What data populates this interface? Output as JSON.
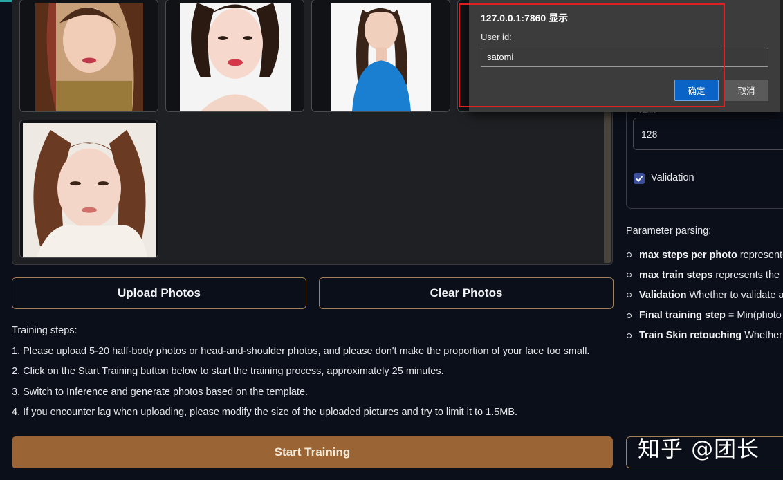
{
  "gallery": {
    "photos": [
      {
        "alt": "portrait photo 1"
      },
      {
        "alt": "portrait photo 2"
      },
      {
        "alt": "portrait photo 3"
      },
      {
        "alt": "portrait photo 4"
      },
      {
        "alt": "portrait photo 5"
      }
    ]
  },
  "buttons": {
    "upload": "Upload Photos",
    "clear": "Clear Photos",
    "start": "Start Training"
  },
  "steps": {
    "title": "Training steps:",
    "items": [
      "1. Please upload 5-20 half-body photos or head-and-shoulder photos, and please don't make the proportion of your face too small.",
      "2. Click on the Start Training button below to start the training process, approximately 25 minutes.",
      "3. Switch to Inference and generate photos based on the template.",
      "4. If you encounter lag when uploading, please modify the size of the uploaded pictures and try to limit it to 1.5MB."
    ]
  },
  "settings": {
    "rank_label": "rank",
    "rank_value": "128",
    "validation_label": "Validation",
    "validation_checked": true
  },
  "params": {
    "title": "Parameter parsing:",
    "items": [
      {
        "key": "max steps per photo",
        "text": "represents"
      },
      {
        "key": "max train steps",
        "text": "represents the m"
      },
      {
        "key": "Validation",
        "text": "Whether to validate a"
      },
      {
        "key": "Final training step",
        "text": "= Min(photo_"
      },
      {
        "key": "Train Skin retouching",
        "text": "Whether t"
      }
    ]
  },
  "dialog": {
    "title": "127.0.0.1:7860 显示",
    "label": "User id:",
    "input_value": "satomi",
    "ok": "确定",
    "cancel": "取消"
  },
  "watermark": "知乎 @团长",
  "colors": {
    "accent": "#9a6435",
    "border_accent": "#a58058",
    "dialog_ok": "#0a63c6",
    "highlight_frame": "#e02020"
  }
}
